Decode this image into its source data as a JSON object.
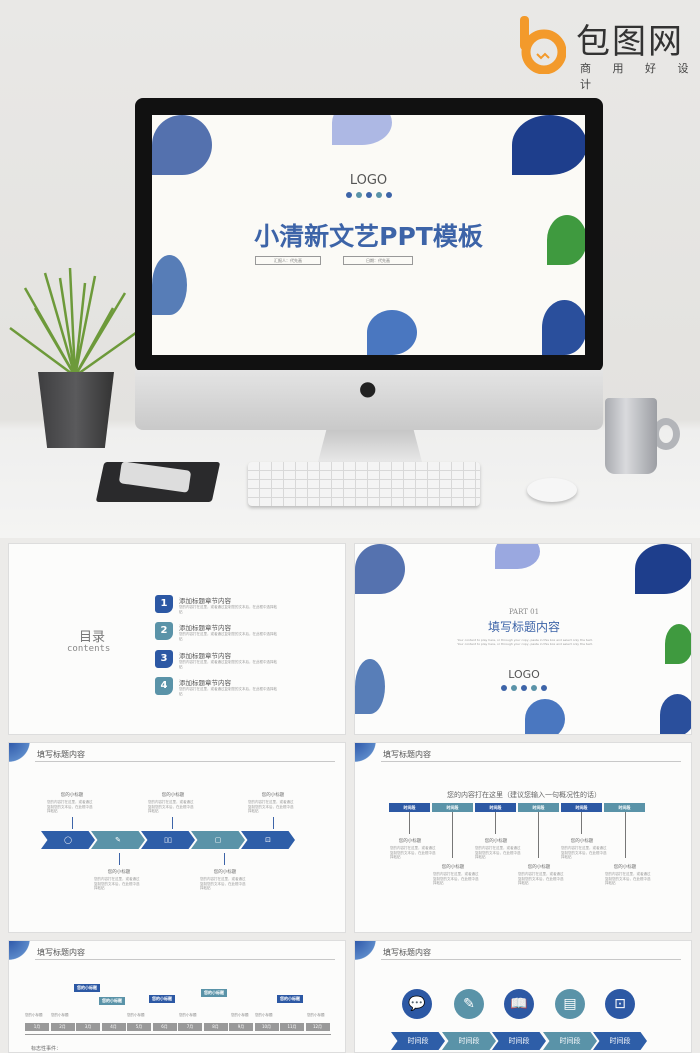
{
  "brand": {
    "name": "包图网",
    "slogan": "商 用 好 设 计",
    "color": "#f39a2b"
  },
  "colors": {
    "blue": "#3d64a8",
    "teal": "#5a93a8"
  },
  "hero_slide": {
    "logo": "LOGO",
    "title": "小清新文艺PPT模板",
    "presenter": "汇报人：代先画",
    "date": "日期：代先画"
  },
  "slides": {
    "toc": {
      "title": "目录",
      "subtitle": "contents",
      "items": [
        {
          "num": "1",
          "label": "添加标题章节内容",
          "desc": "您的内容打在这里，或者通过复制您的文本后，在此框中选择粘贴"
        },
        {
          "num": "2",
          "label": "添加标题章节内容",
          "desc": "您的内容打在这里，或者通过复制您的文本后，在此框中选择粘贴"
        },
        {
          "num": "3",
          "label": "添加标题章节内容",
          "desc": "您的内容打在这里，或者通过复制您的文本后，在此框中选择粘贴"
        },
        {
          "num": "4",
          "label": "添加标题章节内容",
          "desc": "您的内容打在这里，或者通过复制您的文本后，在此框中选择粘贴"
        }
      ]
    },
    "part": {
      "part": "PART 01",
      "title": "填写标题内容",
      "body": "Your content to play here, or through your copy, paste in this box and select only the text. Your content to play here, or through your copy, paste in this box and select only the text.",
      "logo": "LOGO"
    },
    "process": {
      "title": "填写标题内容",
      "subtitle": "您的小标题",
      "text": "您的内容打在这里，或者通过复制您的文本后，在此框中选择粘贴",
      "icons": [
        "chat-icon",
        "pencil-icon",
        "book-icon",
        "document-icon",
        "box-icon"
      ]
    },
    "timeline6": {
      "title": "填写标题内容",
      "heading": "您的内容打在这里（建议您输入一句概况性的话）",
      "bar": "时间段",
      "subtitle": "您的小标题",
      "text": "您的内容打在这里，或者通过复制您的文本后，在此框中选择粘贴"
    },
    "months": {
      "title": "填写标题内容",
      "months": [
        "1月",
        "2月",
        "3月",
        "4月",
        "5月",
        "6月",
        "7月",
        "8月",
        "9月",
        "10月",
        "11月",
        "12月"
      ],
      "tag": "您的小标题",
      "small": "您的小标题",
      "footer": "标志性事件："
    },
    "pins": {
      "title": "填写标题内容",
      "bar": "时间段",
      "icons": [
        "chat-icon",
        "pencil-icon",
        "book-icon",
        "document-icon",
        "box-icon"
      ]
    }
  }
}
